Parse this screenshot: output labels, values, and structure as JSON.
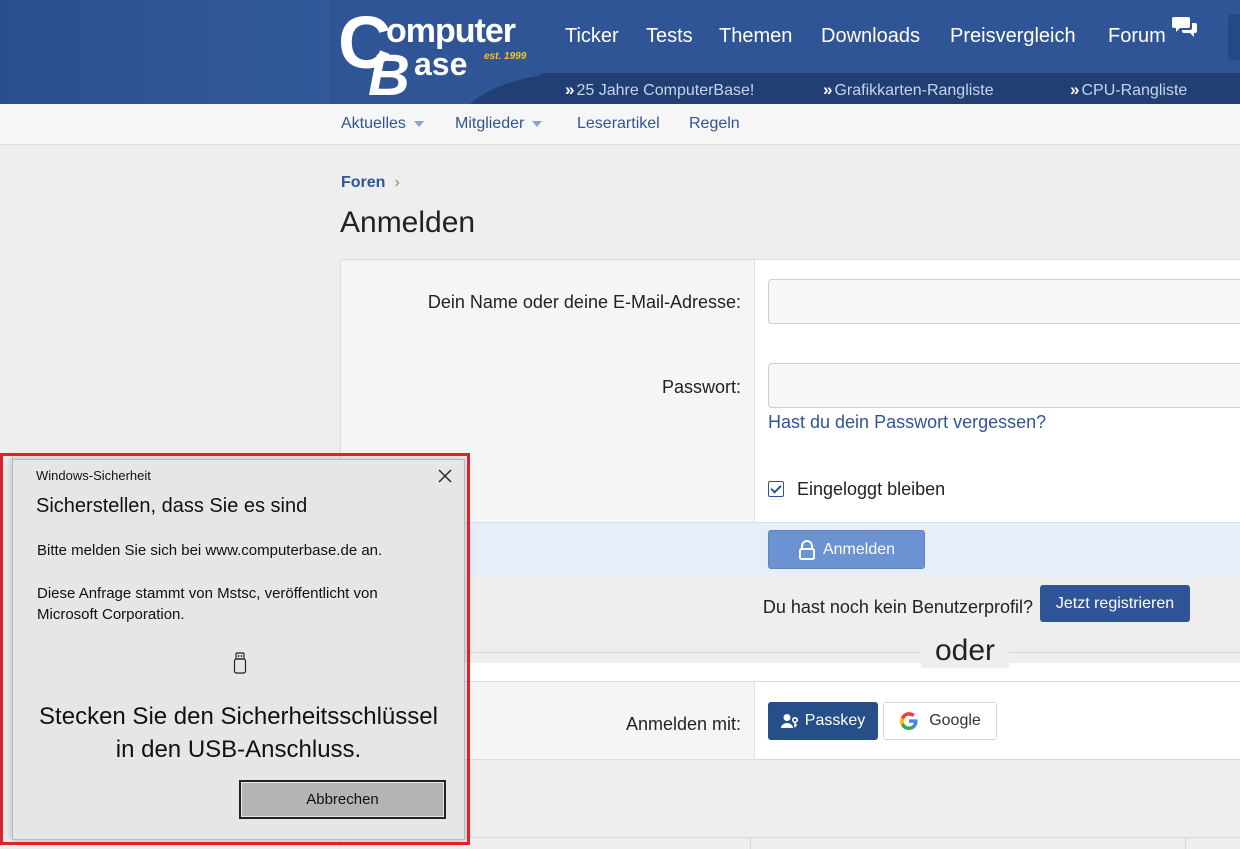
{
  "header": {
    "logo": {
      "c": "C",
      "omputer": "omputer",
      "b": "B",
      "ase": "ase",
      "est": "est. 1999"
    },
    "nav": [
      "Ticker",
      "Tests",
      "Themen",
      "Downloads",
      "Preisvergleich",
      "Forum"
    ],
    "subnav": [
      "25 Jahre ComputerBase!",
      "Grafikkarten-Rangliste",
      "CPU-Rangliste"
    ],
    "subnav_marker": "»"
  },
  "secondary_nav": {
    "items": [
      "Aktuelles",
      "Mitglieder",
      "Leserartikel",
      "Regeln"
    ]
  },
  "breadcrumb": {
    "item": "Foren",
    "separator": "›"
  },
  "page_title": "Anmelden",
  "login_form": {
    "username_label": "Dein Name oder deine E-Mail-Adresse:",
    "username_value": "",
    "password_label": "Passwort:",
    "password_value": "",
    "forgot_password": "Hast du dein Passwort vergessen?",
    "stay_logged_in": "Eingeloggt bleiben",
    "stay_logged_in_checked": true,
    "submit_label": "Anmelden",
    "no_profile_text": "Du hast noch kein Benutzerprofil?",
    "register_label": "Jetzt registrieren",
    "or_text": "oder",
    "login_with_label": "Anmelden mit:",
    "passkey_label": "Passkey",
    "google_label": "Google"
  },
  "dialog": {
    "caption": "Windows-Sicherheit",
    "title": "Sicherstellen, dass Sie es sind",
    "text1": "Bitte melden Sie sich bei www.computerbase.de an.",
    "text2": "Diese Anfrage stammt von Mstsc, veröffentlicht von Microsoft Corporation.",
    "instruction_line1": "Stecken Sie den Sicherheitsschlüssel",
    "instruction_line2": "in den USB-Anschluss.",
    "cancel_label": "Abbrechen"
  },
  "colors": {
    "header_blue": "#2f5597",
    "link_blue": "#2f5597",
    "highlight_red": "#d9232e",
    "logo_accent": "#f6c22e"
  }
}
